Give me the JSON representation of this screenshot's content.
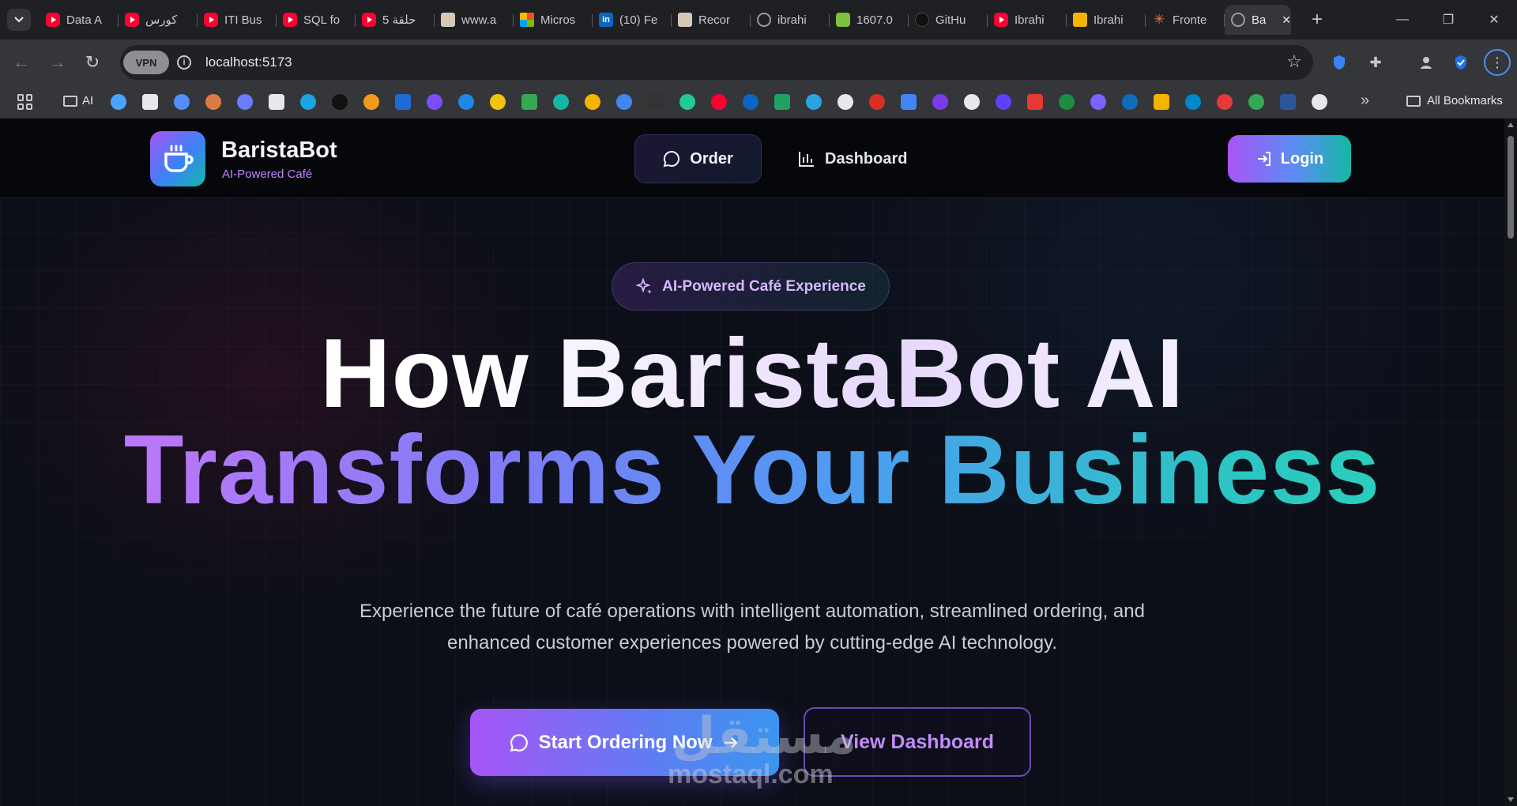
{
  "browser": {
    "tabs": [
      {
        "icon": "youtube-icon",
        "label": "Data A"
      },
      {
        "icon": "youtube-icon",
        "label": "كورس"
      },
      {
        "icon": "youtube-icon",
        "label": "ITI Bus"
      },
      {
        "icon": "youtube-icon",
        "label": "SQL fo"
      },
      {
        "icon": "youtube-icon",
        "label": "5 حلقة"
      },
      {
        "icon": "avatar-icon",
        "label": "www.a"
      },
      {
        "icon": "microsoft-icon",
        "label": "Micros"
      },
      {
        "icon": "linkedin-icon",
        "label": "(10) Fe"
      },
      {
        "icon": "avatar-icon",
        "label": "Recor"
      },
      {
        "icon": "globe-icon",
        "label": "ibrahi"
      },
      {
        "icon": "smiley-icon",
        "label": "1607.0"
      },
      {
        "icon": "github-icon",
        "label": "GitHu"
      },
      {
        "icon": "youtube-icon",
        "label": "Ibrahi"
      },
      {
        "icon": "slides-icon",
        "label": "Ibrahi"
      },
      {
        "icon": "claude-icon",
        "label": "Fronte"
      },
      {
        "icon": "globe-icon",
        "label": "Ba",
        "active": true
      }
    ],
    "address": "localhost:5173",
    "vpn_label": "VPN",
    "bookmarks": {
      "folder_label": "AI",
      "all_label": "All Bookmarks",
      "icon_colors": [
        "#4aa3ff",
        "#e8e8ea",
        "#4f8ff7",
        "#e07a44",
        "#6b7cff",
        "#e8e8ea",
        "#1aa6e0",
        "#111111",
        "#f29b1d",
        "#1e6bd6",
        "#7c4dff",
        "#1e88e5",
        "#f4c20d",
        "#34a853",
        "#14b8a6",
        "#f4b400",
        "#4285f4",
        "#333333",
        "#20c997",
        "#ff0033",
        "#0a66c2",
        "#1ea362",
        "#2aa3e0",
        "#e8e8ea",
        "#d93025",
        "#4285f4",
        "#7c3aed",
        "#e8e8ea",
        "#5f40ff",
        "#e53935",
        "#1e8e3e",
        "#7b61ff",
        "#0f6cbd",
        "#f4b400",
        "#0088cc",
        "#e53935",
        "#34a853",
        "#2b579a",
        "#e8e8ea"
      ]
    }
  },
  "site": {
    "brand": "BaristaBot",
    "tagline": "AI-Powered Café",
    "nav": {
      "order": "Order",
      "dashboard": "Dashboard",
      "login": "Login"
    },
    "hero": {
      "badge": "AI-Powered Café Experience",
      "title_line1": "How BaristaBot AI",
      "title_line2": "Transforms Your Business",
      "subtitle": "Experience the future of café operations with intelligent automation, streamlined ordering, and enhanced customer experiences powered by cutting-edge AI technology.",
      "cta_primary": "Start Ordering Now",
      "cta_secondary": "View Dashboard"
    },
    "colors": {
      "accent_purple": "#a855f7",
      "accent_blue": "#3b82f6",
      "accent_teal": "#14b8a6"
    }
  },
  "watermark": {
    "arabic": "مستقل",
    "latin": "mostaql.com"
  }
}
